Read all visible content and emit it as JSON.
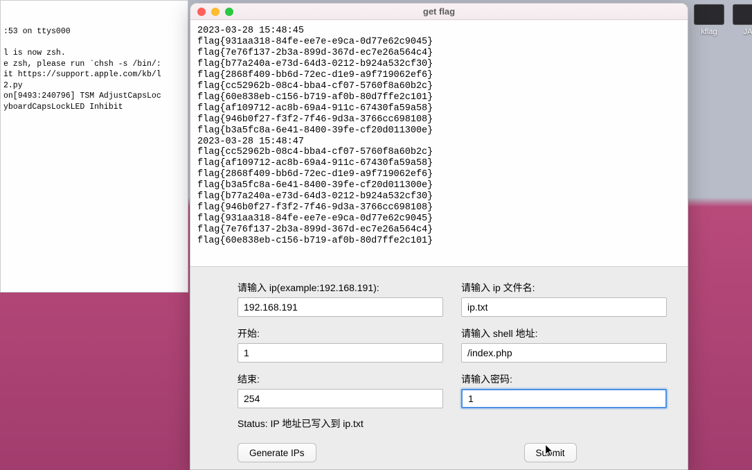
{
  "desktop": {
    "icons": [
      {
        "label": "kflag"
      },
      {
        "label": "JA"
      }
    ]
  },
  "background_terminal": {
    "lines": ":53 on ttys000\n\nl is now zsh.\ne zsh, please run `chsh -s /bin/:\nit https://support.apple.com/kb/l\n2.py\non[9493:240796] TSM AdjustCapsLoc\nyboardCapsLockLED Inhibit"
  },
  "window": {
    "title": "get flag",
    "output_lines": [
      "2023-03-28 15:48:45",
      "flag{931aa318-84fe-ee7e-e9ca-0d77e62c9045}",
      "flag{7e76f137-2b3a-899d-367d-ec7e26a564c4}",
      "flag{b77a240a-e73d-64d3-0212-b924a532cf30}",
      "flag{2868f409-bb6d-72ec-d1e9-a9f719062ef6}",
      "flag{cc52962b-08c4-bba4-cf07-5760f8a60b2c}",
      "flag{60e838eb-c156-b719-af0b-80d7ffe2c101}",
      "flag{af109712-ac8b-69a4-911c-67430fa59a58}",
      "flag{946b0f27-f3f2-7f46-9d3a-3766cc698108}",
      "flag{b3a5fc8a-6e41-8400-39fe-cf20d011300e}",
      "2023-03-28 15:48:47",
      "flag{cc52962b-08c4-bba4-cf07-5760f8a60b2c}",
      "flag{af109712-ac8b-69a4-911c-67430fa59a58}",
      "flag{2868f409-bb6d-72ec-d1e9-a9f719062ef6}",
      "flag{b3a5fc8a-6e41-8400-39fe-cf20d011300e}",
      "flag{b77a240a-e73d-64d3-0212-b924a532cf30}",
      "flag{946b0f27-f3f2-7f46-9d3a-3766cc698108}",
      "flag{931aa318-84fe-ee7e-e9ca-0d77e62c9045}",
      "flag{7e76f137-2b3a-899d-367d-ec7e26a564c4}",
      "flag{60e838eb-c156-b719-af0b-80d7ffe2c101}"
    ],
    "form": {
      "ip_label": "请输入 ip(example:192.168.191):",
      "ip_value": "192.168.191",
      "start_label": "开始:",
      "start_value": "1",
      "end_label": "结束:",
      "end_value": "254",
      "ipfile_label": "请输入 ip 文件名:",
      "ipfile_value": "ip.txt",
      "shell_label": "请输入 shell 地址:",
      "shell_value": "/index.php",
      "pwd_label": "请输入密码:",
      "pwd_value": "1",
      "status": "Status: IP 地址已写入到 ip.txt",
      "generate_btn": "Generate IPs",
      "submit_btn": "Submit"
    }
  }
}
